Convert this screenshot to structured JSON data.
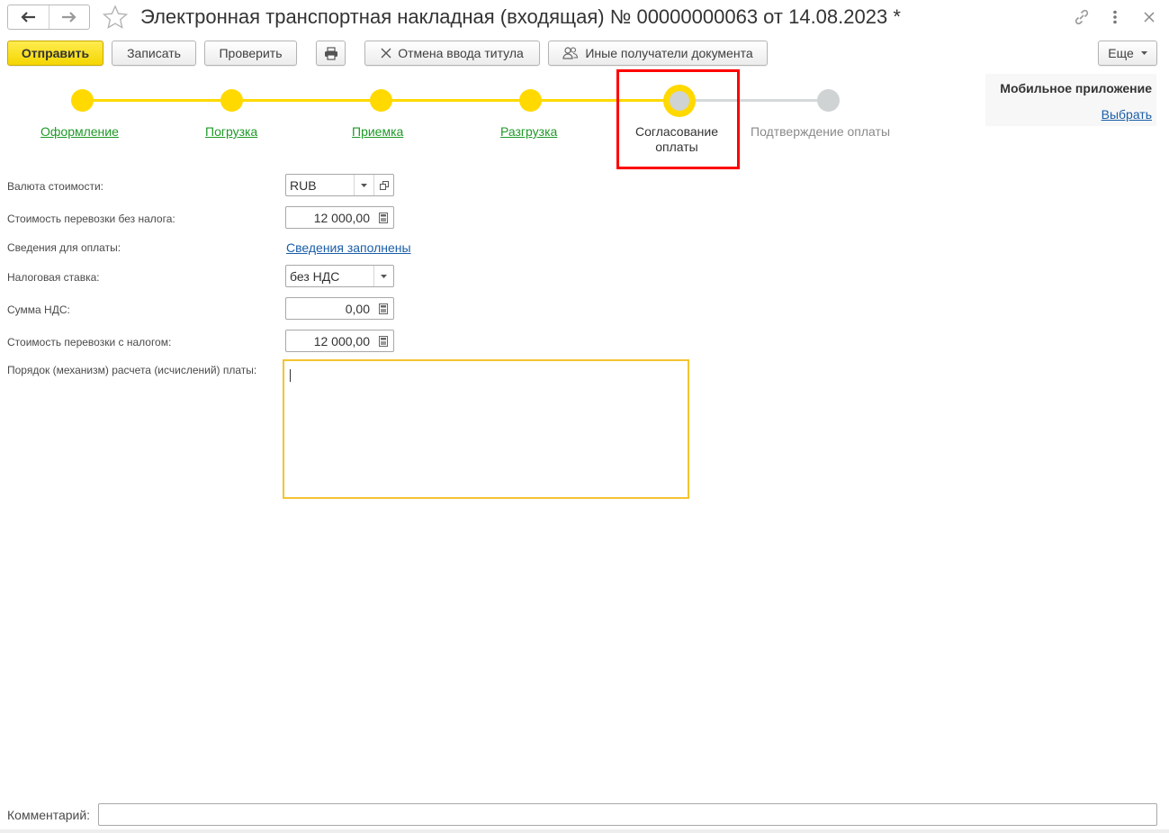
{
  "window": {
    "title": "Электронная транспортная накладная (входящая) № 00000000063 от 14.08.2023 *"
  },
  "toolbar": {
    "send_label": "Отправить",
    "save_label": "Записать",
    "check_label": "Проверить",
    "cancel_title_label": "Отмена ввода титула",
    "other_recipients_label": "Иные получатели документа",
    "more_label": "Еще"
  },
  "stepper": {
    "steps": [
      {
        "label": "Оформление",
        "state": "done"
      },
      {
        "label": "Погрузка",
        "state": "done"
      },
      {
        "label": "Приемка",
        "state": "done"
      },
      {
        "label": "Разгрузка",
        "state": "done"
      },
      {
        "label": "Согласование оплаты",
        "state": "current"
      },
      {
        "label": "Подтверждение оплаты",
        "state": "pending"
      }
    ]
  },
  "mobile_app": {
    "title": "Мобильное приложение",
    "select_label": "Выбрать"
  },
  "form": {
    "currency": {
      "label": "Валюта стоимости:",
      "value": "RUB"
    },
    "cost_without_tax": {
      "label": "Стоимость перевозки без налога:",
      "value": "12 000,00"
    },
    "payment_info": {
      "label": "Сведения для оплаты:",
      "value": "Сведения заполнены"
    },
    "tax_rate": {
      "label": "Налоговая ставка:",
      "value": "без НДС"
    },
    "vat_amount": {
      "label": "Сумма НДС:",
      "value": "0,00"
    },
    "cost_with_tax": {
      "label": "Стоимость перевозки с налогом:",
      "value": "12 000,00"
    },
    "payment_procedure": {
      "label": "Порядок (механизм) расчета (исчислений) платы:",
      "value": ""
    },
    "comment": {
      "label": "Комментарий:",
      "value": ""
    }
  },
  "colors": {
    "accent_yellow": "#ffd900",
    "step_pending": "#cfd3d4",
    "link_green": "#1e9a28",
    "link_blue": "#1a5ea8",
    "highlight_red": "#ff0000"
  }
}
